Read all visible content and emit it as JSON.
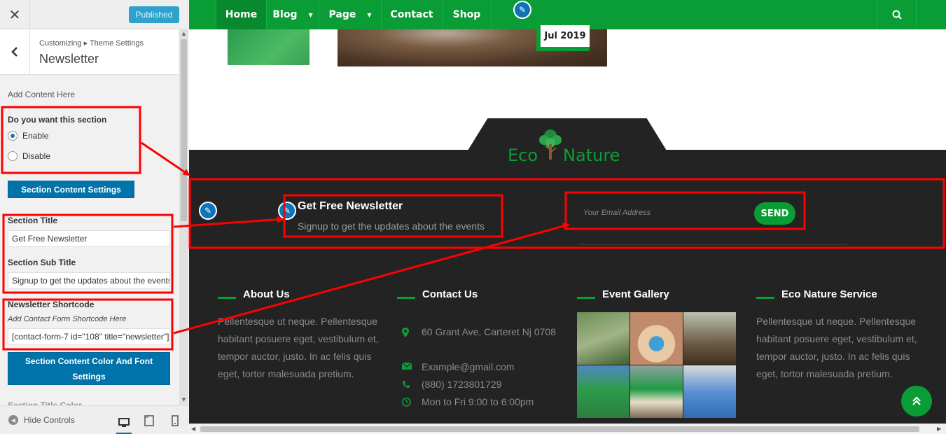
{
  "sidebar": {
    "close_icon": "close-icon",
    "published_label": "Published",
    "breadcrumb": "Customizing ▸ Theme Settings",
    "panel_title": "Newsletter",
    "add_content_label": "Add Content Here",
    "section_toggle": {
      "label": "Do you want this section",
      "options": [
        "Enable",
        "Disable"
      ],
      "selected": "Enable"
    },
    "content_settings_button": "Section Content Settings",
    "section_title_label": "Section Title",
    "section_title_value": "Get Free Newsletter",
    "section_subtitle_label": "Section Sub Title",
    "section_subtitle_value": "Signup to get the updates about the events",
    "shortcode_label": "Newsletter Shortcode",
    "shortcode_description": "Add Contact Form Shortcode Here",
    "shortcode_value": "[contact-form-7 id=\"108\" title=\"newsletter\"]",
    "color_font_button": "Section Content Color And Font Settings",
    "cut_off_label": "Section Title Color",
    "hide_controls_label": "Hide Controls",
    "devices": [
      "desktop-icon",
      "tablet-icon",
      "mobile-icon"
    ]
  },
  "preview": {
    "nav": {
      "items": [
        {
          "label": "Home",
          "active": true
        },
        {
          "label": "Blog",
          "dropdown": true
        },
        {
          "label": "Page",
          "dropdown": true
        },
        {
          "label": "Contact"
        },
        {
          "label": "Shop"
        }
      ],
      "search_icon": "search-icon"
    },
    "date_badge": "Jul 2019",
    "logo": {
      "left": "Eco",
      "right": "Nature"
    },
    "newsletter": {
      "title": "Get Free Newsletter",
      "subtitle": "Signup to get the updates about the events",
      "email_placeholder": "Your Email Address",
      "send_label": "SEND"
    },
    "footer": {
      "about": {
        "title": "About Us",
        "text": "Pellentesque ut neque. Pellentesque habitant posuere eget, vestibulum et, tempor auctor, justo. In ac felis quis eget, tortor malesuada pretium."
      },
      "contact": {
        "title": "Contact Us",
        "address": "60 Grant Ave, Carteret Nj 0708",
        "email": "Example@gmail.com",
        "phone": "(880) 1723801729",
        "hours": "Mon to Fri 9:00 to 6:00pm"
      },
      "gallery": {
        "title": "Event Gallery",
        "image_count": 6
      },
      "service": {
        "title": "Eco Nature Service",
        "text": "Pellentesque ut neque. Pellentesque habitant posuere eget, vestibulum et, tempor auctor, justo. In ac felis quis eget, tortor malesuada pretium."
      }
    },
    "back_to_top_icon": "double-chevron-up-icon"
  },
  "colors": {
    "brand_green": "#0a9d35",
    "wp_blue": "#0073aa",
    "footer_dark": "#232323",
    "annotation_red": "#ff0000"
  }
}
